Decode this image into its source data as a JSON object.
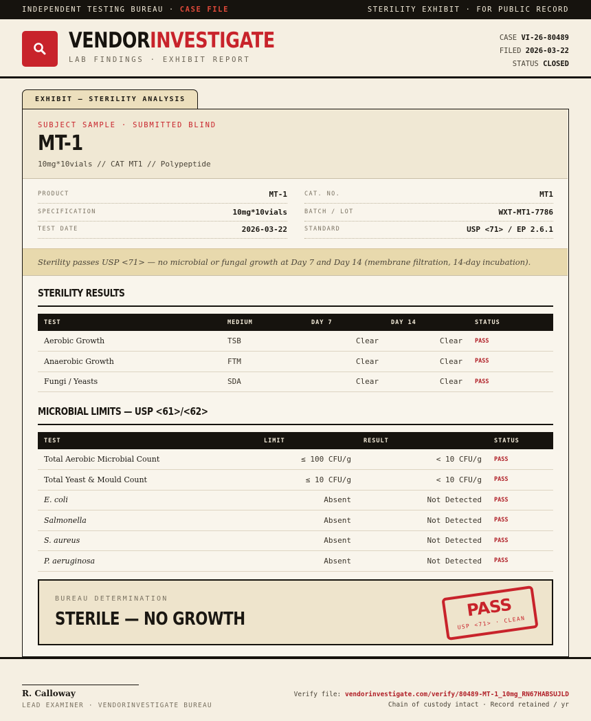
{
  "topbar": {
    "left_prefix": "INDEPENDENT TESTING BUREAU · ",
    "left_highlight": "CASE FILE",
    "right": "STERILITY EXHIBIT · FOR PUBLIC RECORD"
  },
  "header": {
    "brand_part1": "VENDOR",
    "brand_part2": "INVESTIGATE",
    "subtitle": "LAB FINDINGS · EXHIBIT REPORT",
    "case_label": "CASE",
    "case_value": "VI-26-80489",
    "filed_label": "FILED",
    "filed_value": "2026-03-22",
    "status_label": "STATUS",
    "status_value": "CLOSED",
    "logo_icon": "magnifier-icon",
    "accent": "#c8232b"
  },
  "tab": {
    "label": "EXHIBIT — STERILITY ANALYSIS"
  },
  "subject": {
    "kicker": "SUBJECT SAMPLE · SUBMITTED BLIND",
    "title": "MT-1",
    "desc": "10mg*10vials  //  CAT MT1  //  Polypeptide"
  },
  "meta": {
    "product_label": "PRODUCT",
    "product_value": "MT-1",
    "spec_label": "SPECIFICATION",
    "spec_value": "10mg*10vials",
    "date_label": "TEST DATE",
    "date_value": "2026-03-22",
    "cat_label": "CAT. NO.",
    "cat_value": "MT1",
    "batch_label": "BATCH / LOT",
    "batch_value": "WXT-MT1-7786",
    "standard_label": "STANDARD",
    "standard_value": "USP <71> / EP 2.6.1"
  },
  "summary": "Sterility passes USP <71> — no microbial or fungal growth at Day 7 and Day 14 (membrane filtration, 14-day incubation).",
  "sterility": {
    "title": "STERILITY RESULTS",
    "headers": [
      "TEST",
      "MEDIUM",
      "DAY 7",
      "DAY 14",
      "STATUS"
    ],
    "rows": [
      {
        "test": "Aerobic Growth",
        "medium": "TSB",
        "day7": "Clear",
        "day14": "Clear",
        "status": "PASS"
      },
      {
        "test": "Anaerobic Growth",
        "medium": "FTM",
        "day7": "Clear",
        "day14": "Clear",
        "status": "PASS"
      },
      {
        "test": "Fungi / Yeasts",
        "medium": "SDA",
        "day7": "Clear",
        "day14": "Clear",
        "status": "PASS"
      }
    ]
  },
  "microbial": {
    "title": "MICROBIAL LIMITS — USP <61>/<62>",
    "headers": [
      "TEST",
      "LIMIT",
      "RESULT",
      "STATUS"
    ],
    "rows": [
      {
        "test": "Total Aerobic Microbial Count",
        "limit": "≤ 100 CFU/g",
        "result": "< 10 CFU/g",
        "status": "PASS"
      },
      {
        "test": "Total Yeast & Mould Count",
        "limit": "≤ 10 CFU/g",
        "result": "< 10 CFU/g",
        "status": "PASS"
      },
      {
        "test": "E. coli",
        "limit": "Absent",
        "result": "Not Detected",
        "status": "PASS"
      },
      {
        "test": "Salmonella",
        "limit": "Absent",
        "result": "Not Detected",
        "status": "PASS"
      },
      {
        "test": "S. aureus",
        "limit": "Absent",
        "result": "Not Detected",
        "status": "PASS"
      },
      {
        "test": "P. aeruginosa",
        "limit": "Absent",
        "result": "Not Detected",
        "status": "PASS"
      }
    ]
  },
  "determination": {
    "label": "BUREAU DETERMINATION",
    "value": "STERILE — NO GROWTH",
    "stamp_main": "PASS",
    "stamp_sub": "USP <71> · CLEAN"
  },
  "footer": {
    "signer": "R. Calloway",
    "role": "LEAD EXAMINER · VENDORINVESTIGATE BUREAU",
    "verify_label": "Verify file: ",
    "verify_link": "vendorinvestigate.com/verify/80489-MT-1_10mg_RN67HABSUJLD",
    "custody": "Chain of custody intact · Record retained / yr"
  }
}
